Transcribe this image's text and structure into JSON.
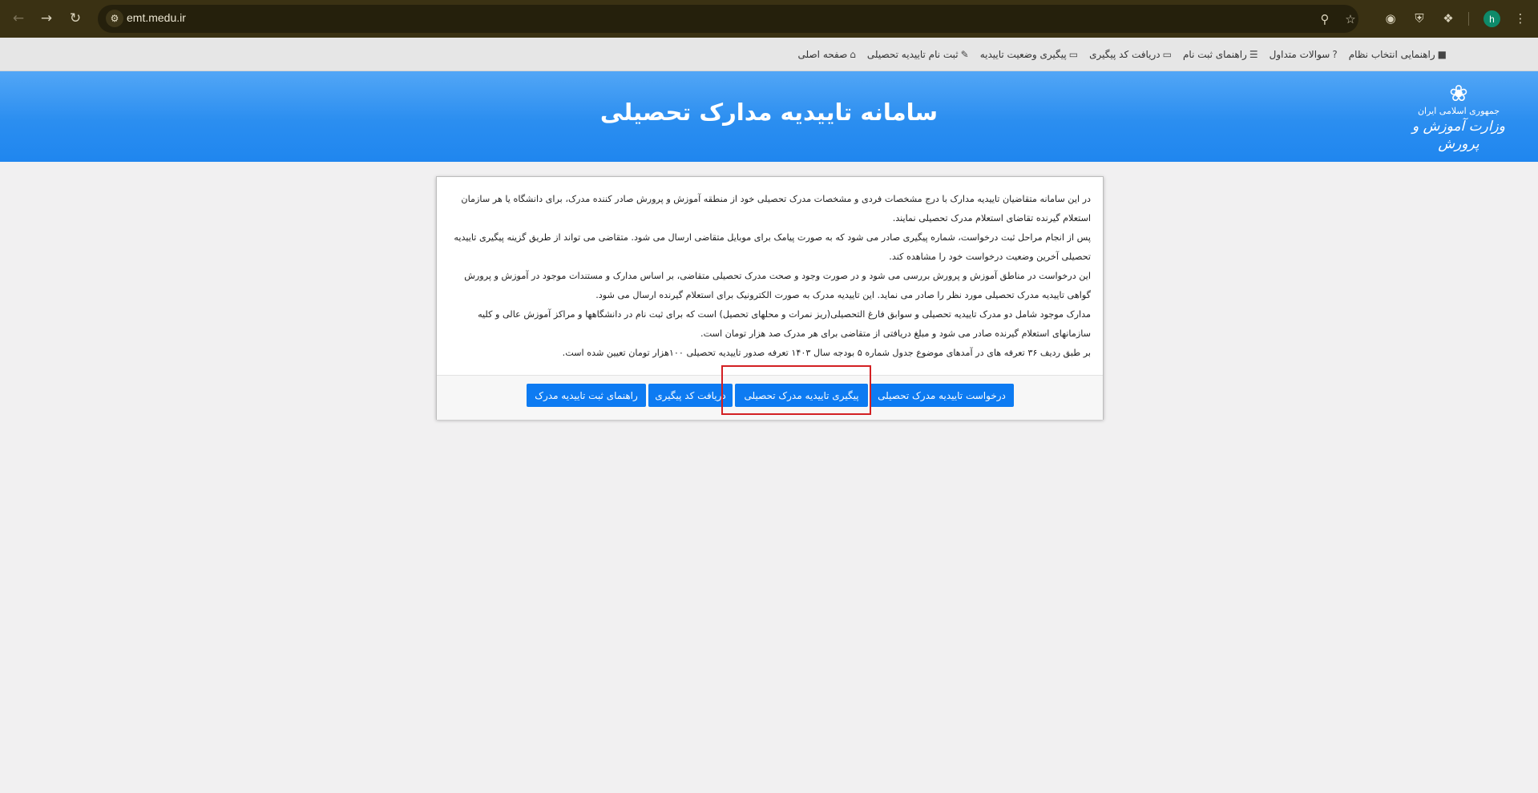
{
  "browser": {
    "url": "emt.medu.ir",
    "avatar_letter": "h"
  },
  "site_nav": {
    "items": [
      {
        "label": "صفحه اصلی",
        "icon": "home-icon"
      },
      {
        "label": "ثبت نام تاییدیه تحصیلی",
        "icon": "edit-icon"
      },
      {
        "label": "پیگیری وضعیت تاییدیه",
        "icon": "card-icon"
      },
      {
        "label": "دریافت کد پیگیری",
        "icon": "card-icon"
      },
      {
        "label": "راهنمای ثبت نام",
        "icon": "list-icon"
      },
      {
        "label": "سوالات متداول",
        "icon": "question-icon"
      },
      {
        "label": "راهنمایی انتخاب نظام",
        "icon": "square-icon"
      }
    ]
  },
  "banner": {
    "title": "سامانه تاییدیه مدارک تحصیلی",
    "logo_line1": "جمهوری اسلامی ایران",
    "logo_line2": "وزارت آموزش و پرورش"
  },
  "content": {
    "paragraphs": [
      "در این سامانه متقاضیان تاییدیه مدارک با درج مشخصات فردی و مشخصات مدرک تحصیلی خود از منطقه آموزش و پرورش صادر کننده مدرک، برای دانشگاه یا هر سازمان استعلام گیرنده تقاضای استعلام مدرک تحصیلی نمایند.",
      "پس از انجام مراحل ثبت درخواست، شماره پیگیری صادر می شود که به صورت پیامک برای موبایل متقاضی ارسال می شود. متقاضی می تواند از طریق گزینه پیگیری تاییدیه تحصیلی آخرین وضعیت درخواست خود را مشاهده کند.",
      "این درخواست در مناطق آموزش و پرورش بررسی می شود و در صورت وجود و صحت مدرک تحصیلی متقاضی، بر اساس مدارک و مستندات موجود در آموزش و پرورش گواهی تاییدیه مدرک تحصیلی مورد نظر را صادر می نماید. این تاییدیه مدرک به صورت الکترونیک برای استعلام گیرنده ارسال می شود.",
      "مدارک موجود شامل دو مدرک تاییدیه تحصیلی و سوابق فارغ التحصیلی(ریز نمرات و محلهای تحصیل) است که برای ثبت نام در دانشگاهها و مراکز آموزش عالی و کلیه سازمانهای استعلام گیرنده صادر می شود و مبلغ دریافتی از متقاضی برای هر مدرک صد هزار تومان است.",
      "بر طبق ردیف ۳۶ تعرفه های در آمدهای موضوع جدول شماره ۵ بودجه سال ۱۴۰۳ تعرفه صدور تاییدیه تحصیلی ۱۰۰هزار تومان تعیین شده است."
    ]
  },
  "buttons": {
    "request": "درخواست تاییدیه مدرک تحصیلی",
    "track": "پیگیری تاییدیه مدرک تحصیلی",
    "get_code": "دریافت کد پیگیری",
    "guide": "راهنمای ثبت تاییدیه مدرک"
  }
}
